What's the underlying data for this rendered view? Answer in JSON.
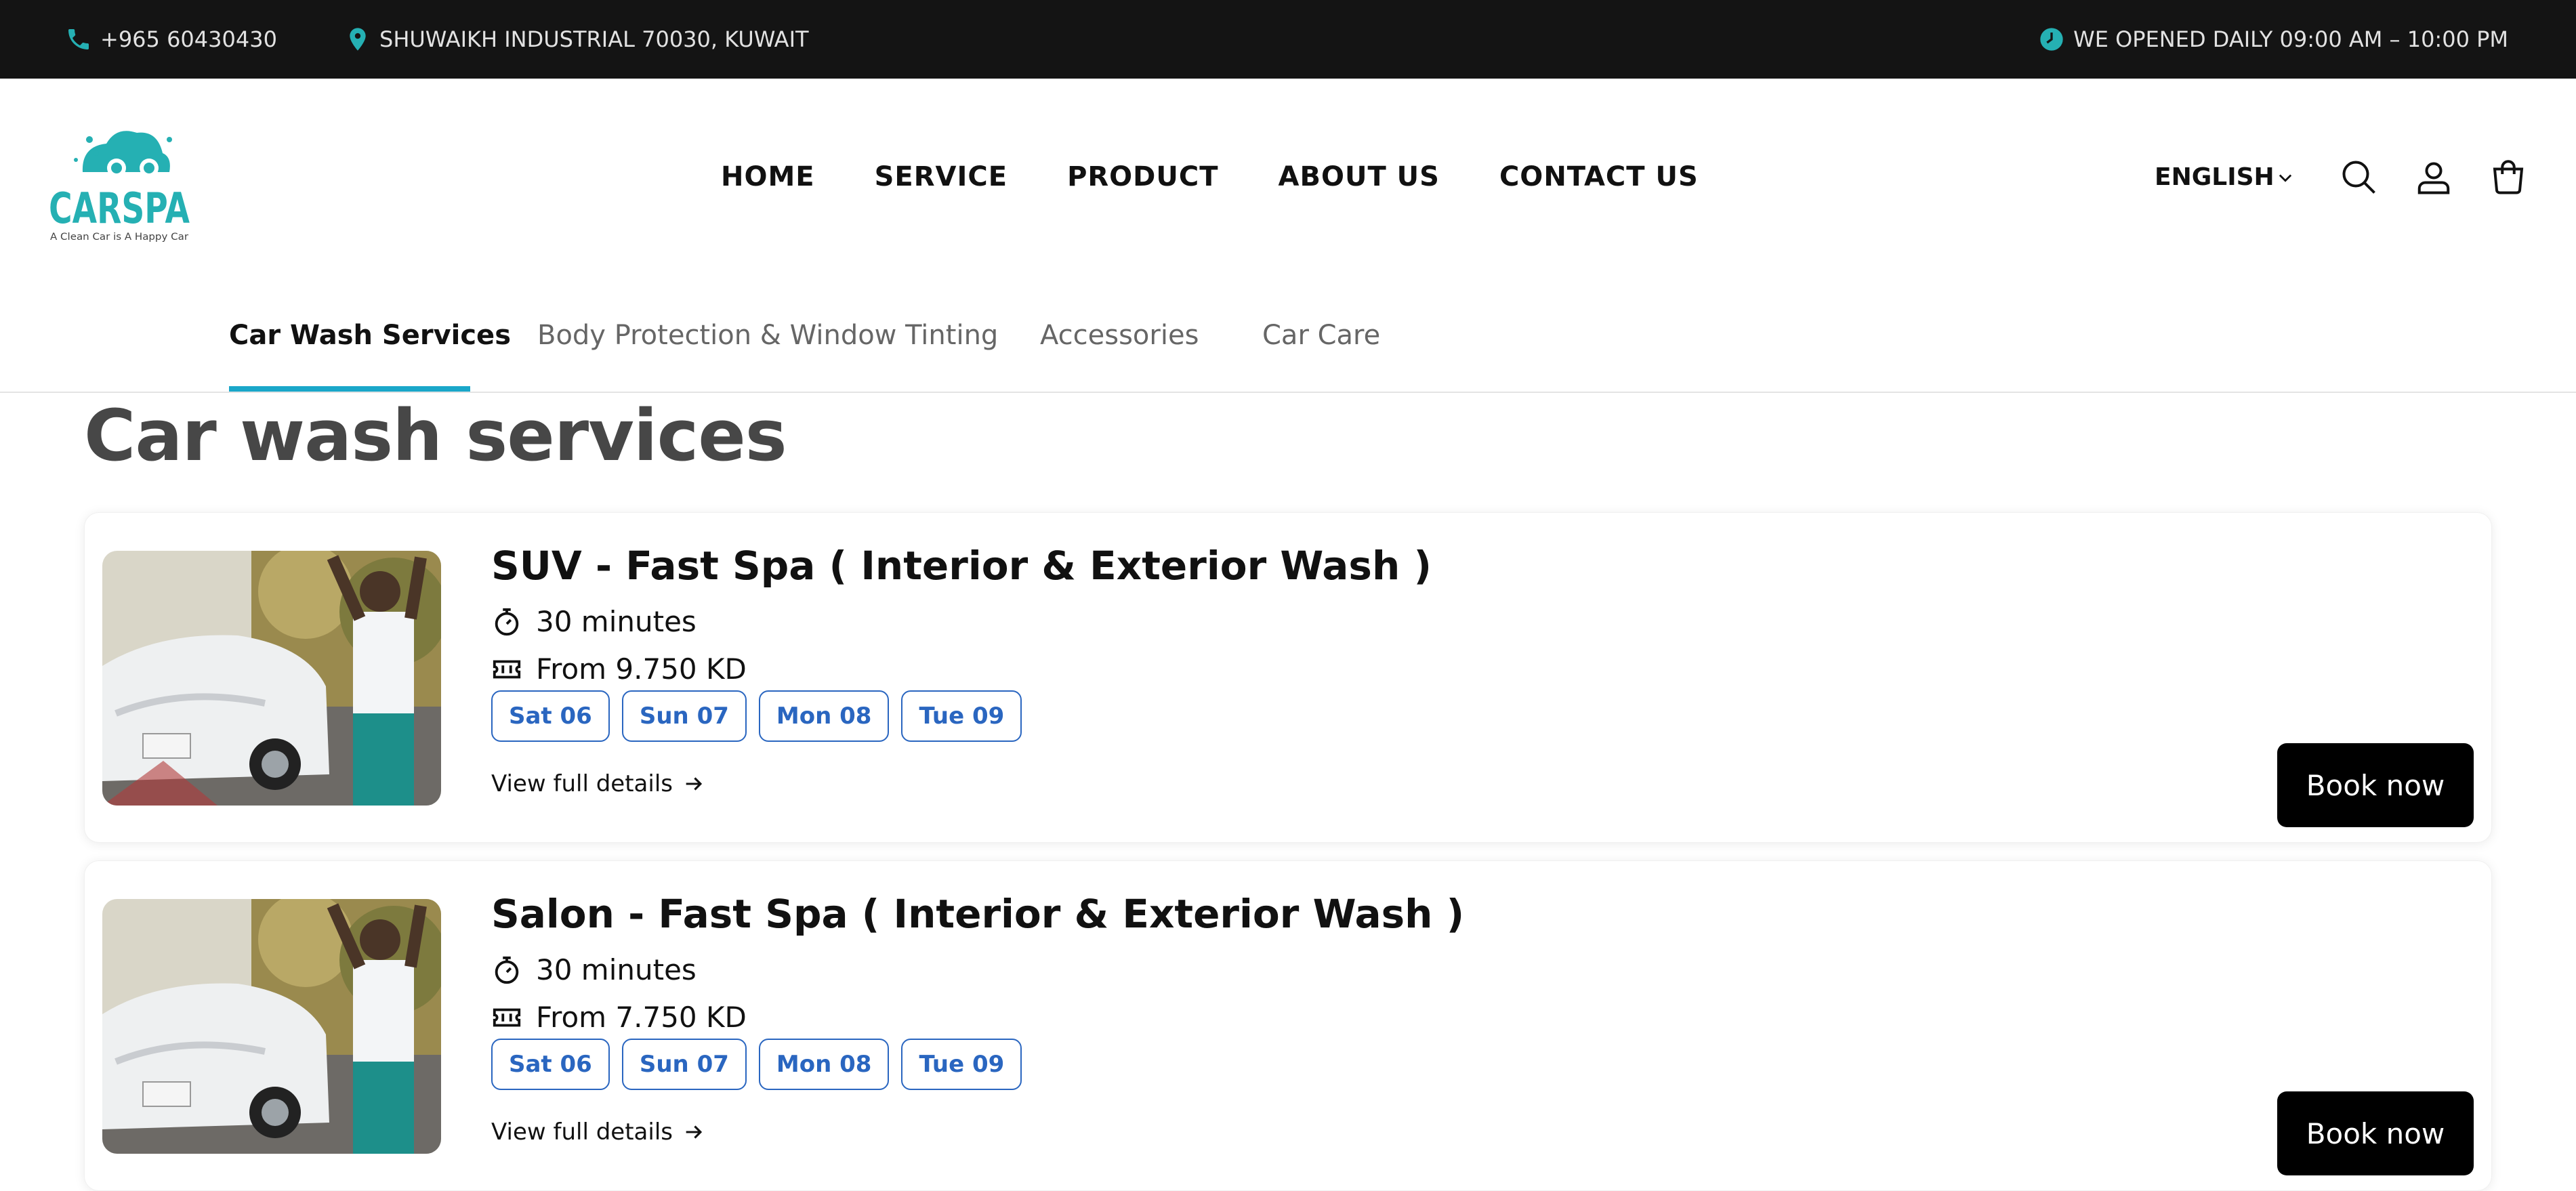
{
  "topbar": {
    "phone": "+965 60430430",
    "address": "SHUWAIKH INDUSTRIAL 70030, KUWAIT",
    "hours": "WE OPENED DAILY 09:00 AM – 10:00 PM"
  },
  "logo": {
    "brand": "CARSPA",
    "tagline": "A Clean Car is A Happy Car"
  },
  "nav": [
    "HOME",
    "SERVICE",
    "PRODUCT",
    "ABOUT US",
    "CONTACT US"
  ],
  "language": "ENGLISH",
  "subtabs": [
    "Car Wash Services",
    "Body Protection & Window Tinting",
    "Accessories",
    "Car Care"
  ],
  "active_subtab": "Car Wash Services",
  "page_title": "Car wash services",
  "services": [
    {
      "title": "SUV - Fast Spa ( Interior & Exterior Wash )",
      "duration": "30 minutes",
      "price": "From 9.750 KD",
      "dates": [
        "Sat 06",
        "Sun 07",
        "Mon 08",
        "Tue 09"
      ],
      "details_label": "View full details",
      "book_label": "Book now"
    },
    {
      "title": "Salon - Fast Spa ( Interior & Exterior Wash )",
      "duration": "30 minutes",
      "price": "From 7.750 KD",
      "dates": [
        "Sat 06",
        "Sun 07",
        "Mon 08",
        "Tue 09"
      ],
      "details_label": "View full details",
      "book_label": "Book now"
    }
  ],
  "icons": {
    "phone": "phone-icon",
    "address": "location-pin-icon",
    "hours": "clock-icon",
    "search": "search-icon",
    "account": "user-icon",
    "cart": "cart-icon",
    "duration": "stopwatch-icon",
    "price": "ticket-icon",
    "details": "arrow-right-icon"
  },
  "colors": {
    "accent": "#1aa7c9",
    "brand_teal": "#25b0b3",
    "chip_blue": "#2a66c0",
    "topbar_bg": "#141414"
  }
}
